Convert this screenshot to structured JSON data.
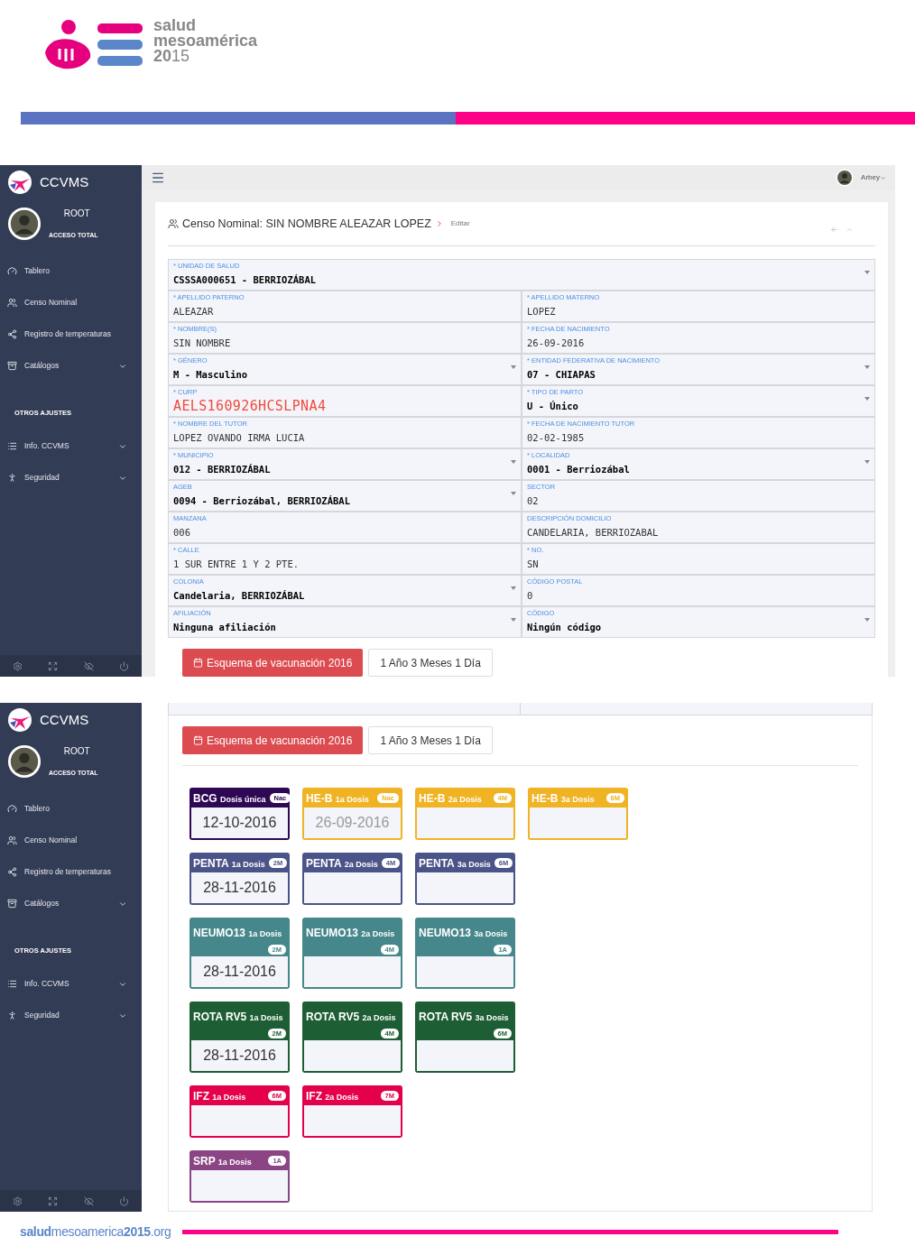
{
  "logo": {
    "line1": "salud",
    "line2": "mesoamérica",
    "line3": "**20**15"
  },
  "screens": [
    {
      "brand": "CCVMS",
      "user": {
        "name": "ROOT",
        "role": "ACCESO TOTAL"
      },
      "sidebar": [
        {
          "kind": "item",
          "label": "Tablero",
          "caret": false
        },
        {
          "kind": "item",
          "label": "Censo Nominal",
          "caret": false
        },
        {
          "kind": "item",
          "label": "Registro de temperaturas",
          "caret": false
        },
        {
          "kind": "item",
          "label": "Catálogos",
          "caret": true
        },
        {
          "kind": "heading",
          "label": "OTROS AJUSTES"
        },
        {
          "kind": "item",
          "label": "Info. CCVMS",
          "caret": true
        },
        {
          "kind": "item",
          "label": "Seguridad",
          "caret": true
        }
      ],
      "topbar": {
        "user": "Arbey"
      },
      "title": {
        "text": "Censo Nominal: SIN NOMBRE ALEAZAR LOPEZ",
        "sub": "Editar"
      },
      "form": [
        [
          {
            "kind": "select",
            "label": "* UNIDAD DE SALUD",
            "value": "CSSSA000651 - BERRIOZÁBAL"
          }
        ],
        [
          {
            "kind": "text",
            "label": "* APELLIDO PATERNO",
            "value": "ALEAZAR"
          },
          {
            "kind": "text",
            "label": "* APELLIDO MATERNO",
            "value": "LOPEZ"
          }
        ],
        [
          {
            "kind": "text",
            "label": "* NOMBRE(S)",
            "value": "SIN NOMBRE"
          },
          {
            "kind": "text",
            "label": "* FECHA DE NACIMIENTO",
            "value": "26-09-2016"
          }
        ],
        [
          {
            "kind": "select",
            "label": "* GÉNERO",
            "value": "M - Masculino"
          },
          {
            "kind": "select",
            "label": "* ENTIDAD FEDERATIVA DE NACIMIENTO",
            "value": "07 - CHIAPAS"
          }
        ],
        [
          {
            "kind": "error",
            "label": "* CURP",
            "value": "AELS160926HCSLPNA4"
          },
          {
            "kind": "select",
            "label": "* TIPO DE PARTO",
            "value": "U - Único"
          }
        ],
        [
          {
            "kind": "text",
            "label": "* NOMBRE DEL TUTOR",
            "value": "LOPEZ OVANDO IRMA LUCIA"
          },
          {
            "kind": "text",
            "label": "* FECHA DE NACIMIENTO TUTOR",
            "value": "02-02-1985"
          }
        ],
        [
          {
            "kind": "select",
            "label": "* MUNICIPIO",
            "value": "012 - BERRIOZÁBAL"
          },
          {
            "kind": "select",
            "label": "* LOCALIDAD",
            "value": "0001 - Berriozábal"
          }
        ],
        [
          {
            "kind": "select",
            "label": "AGEB",
            "value": "0094 - Berriozábal, BERRIOZÁBAL"
          },
          {
            "kind": "text",
            "label": "SECTOR",
            "value": "02"
          }
        ],
        [
          {
            "kind": "text",
            "label": "MANZANA",
            "value": "006"
          },
          {
            "kind": "text",
            "label": "DESCRIPCIÓN DOMICILIO",
            "value": "CANDELARIA, BERRIOZABAL"
          }
        ],
        [
          {
            "kind": "text",
            "label": "* CALLE",
            "value": "1 SUR ENTRE 1 Y 2 PTE."
          },
          {
            "kind": "text",
            "label": "* NO.",
            "value": "SN"
          }
        ],
        [
          {
            "kind": "select",
            "label": "COLONIA",
            "value": "Candelaria, BERRIOZÁBAL"
          },
          {
            "kind": "text",
            "label": "CÓDIGO POSTAL",
            "value": "0"
          }
        ],
        [
          {
            "kind": "select",
            "label": "AFILIACIÓN",
            "value": "Ninguna afiliación"
          },
          {
            "kind": "select",
            "label": "CÓDIGO",
            "value": "Ningún código"
          }
        ]
      ],
      "buttons": {
        "scheme": "Esquema de vacunación 2016",
        "age": "1 Año 3 Meses 1 Día"
      }
    },
    {
      "brand": "CCVMS",
      "user": {
        "name": "ROOT",
        "role": "ACCESO TOTAL"
      },
      "sidebar": [
        {
          "kind": "item",
          "label": "Tablero",
          "caret": false
        },
        {
          "kind": "item",
          "label": "Censo Nominal",
          "caret": false
        },
        {
          "kind": "item",
          "label": "Registro de temperaturas",
          "caret": false
        },
        {
          "kind": "item",
          "label": "Catálogos",
          "caret": true
        },
        {
          "kind": "heading",
          "label": "OTROS AJUSTES"
        },
        {
          "kind": "item",
          "label": "Info. CCVMS",
          "caret": true
        },
        {
          "kind": "item",
          "label": "Seguridad",
          "caret": true
        }
      ],
      "buttons": {
        "scheme": "Esquema de vacunación 2016",
        "age": "1 Año 3 Meses 1 Día"
      },
      "vaccines": [
        [
          {
            "kind": "inline",
            "name": "BCG",
            "dose": "Dosis única",
            "badge": "Nac",
            "color": "#2e0854",
            "date": "12-10-2016",
            "muted": false
          },
          {
            "kind": "inline",
            "name": "HE-B",
            "dose": "1a Dosis",
            "badge": "Nac",
            "color": "#f0b323",
            "date": "26-09-2016",
            "muted": true
          },
          {
            "kind": "inline",
            "name": "HE-B",
            "dose": "2a Dosis",
            "badge": "4M",
            "color": "#f0b323"
          },
          {
            "kind": "inline",
            "name": "HE-B",
            "dose": "3a Dosis",
            "badge": "6M",
            "color": "#f0b323"
          }
        ],
        [
          {
            "kind": "inline",
            "name": "PENTA",
            "dose": "1a Dosis",
            "badge": "2M",
            "color": "#4a5488",
            "date": "28-11-2016",
            "muted": false
          },
          {
            "kind": "inline",
            "name": "PENTA",
            "dose": "2a Dosis",
            "badge": "4M",
            "color": "#4a5488"
          },
          {
            "kind": "inline",
            "name": "PENTA",
            "dose": "3a Dosis",
            "badge": "6M",
            "color": "#4a5488"
          }
        ],
        [
          {
            "kind": "stacked",
            "name": "NEUMO13",
            "dose": "1a Dosis",
            "badge": "2M",
            "color": "#45878a",
            "date": "28-11-2016",
            "muted": false
          },
          {
            "kind": "stacked",
            "name": "NEUMO13",
            "dose": "2a Dosis",
            "badge": "4M",
            "color": "#45878a"
          },
          {
            "kind": "stacked",
            "name": "NEUMO13",
            "dose": "3a Dosis",
            "badge": "1A",
            "color": "#45878a"
          }
        ],
        [
          {
            "kind": "stacked",
            "name": "ROTA RV5",
            "dose": "1a Dosis",
            "badge": "2M",
            "color": "#1e5e34",
            "date": "28-11-2016",
            "muted": false
          },
          {
            "kind": "stacked",
            "name": "ROTA RV5",
            "dose": "2a Dosis",
            "badge": "4M",
            "color": "#1e5e34"
          },
          {
            "kind": "stacked",
            "name": "ROTA RV5",
            "dose": "3a Dosis",
            "badge": "6M",
            "color": "#1e5e34"
          }
        ],
        [
          {
            "kind": "inline",
            "name": "IFZ",
            "dose": "1a Dosis",
            "badge": "6M",
            "color": "#e4004b"
          },
          {
            "kind": "inline",
            "name": "IFZ",
            "dose": "2a Dosis",
            "badge": "7M",
            "color": "#e4004b"
          }
        ],
        [
          {
            "kind": "inline",
            "name": "SRP",
            "dose": "1a Dosis",
            "badge": "1A",
            "color": "#8b4584"
          }
        ]
      ]
    }
  ],
  "footer": {
    "url": "**salud**mesoamerica**2015**.org"
  }
}
